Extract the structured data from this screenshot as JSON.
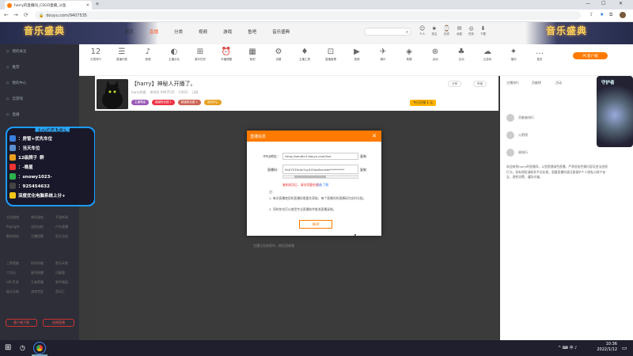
{
  "browser": {
    "tab_title": "harry的直播间_CSGO直播_斗鱼",
    "new_tab": "+",
    "url": "douyu.com/9407535",
    "win_min": "—",
    "win_max": "☐",
    "win_close": "✕",
    "nav_back": "←",
    "nav_fwd": "→",
    "nav_reload": "⟳",
    "lock": "🔒"
  },
  "site": {
    "logo_left": "音乐盛典",
    "logo_right": "音乐盛典",
    "nav": [
      "首页",
      "直播",
      "分类",
      "视频",
      "游戏",
      "鱼吧",
      "音乐盛典"
    ],
    "nav_active": 1,
    "header_icons": [
      {
        "icon": "☺",
        "label": "个人"
      },
      {
        "icon": "★",
        "label": "关注"
      },
      {
        "icon": "⌚",
        "label": "历史"
      },
      {
        "icon": "✉",
        "label": "消息"
      },
      {
        "icon": "◎",
        "label": "任务"
      },
      {
        "icon": "⬇",
        "label": "下载"
      }
    ]
  },
  "sidebar": {
    "items": [
      "我的关注",
      "推荐",
      "我的中心",
      "云游戏",
      "直播"
    ],
    "small_rows": [
      [
        "主机游戏",
        "单机游戏",
        "手游休闲"
      ],
      [
        "Popright",
        "全民自拍",
        "户外直播"
      ],
      [
        "数码科技",
        "主播招募",
        "官方活动"
      ]
    ],
    "small_rows2": [
      [
        "三家智能",
        "科学技能",
        "鱼乐天地"
      ],
      [
        "二次元",
        "星秀直播",
        "正能量"
      ],
      [
        "LOL手游",
        "王者荣耀",
        "和平精英"
      ],
      [
        "娱乐天地",
        "游戏专区",
        "音乐汇"
      ]
    ],
    "btn_left": "客户端下载",
    "btn_right": "创建直播"
  },
  "fan_panel": {
    "title": "喜欢的点点关注哦",
    "lines": [
      {
        "text": "：房管+优先车位",
        "color": "#3b7ddd"
      },
      {
        "text": "：当天车位",
        "color": "#5b8fd0"
      },
      {
        "text": "12级牌子",
        "color": "#e8a020"
      },
      {
        "text": "：-晚星",
        "color": "#e33"
      },
      {
        "text": "：snowy1023-",
        "color": "#2bb24c"
      },
      {
        "text": "：925454632",
        "color": "#444"
      },
      {
        "text": "深度优化电脑系统上分+",
        "color": "#f5c518"
      }
    ],
    "group_suffix": "群"
  },
  "icon_bar": {
    "items": [
      {
        "icon": "12",
        "label": "分类排行"
      },
      {
        "icon": "☰",
        "label": "直播列表"
      },
      {
        "icon": "♪",
        "label": "音频"
      },
      {
        "icon": "◐",
        "label": "主播论坛"
      },
      {
        "icon": "⊞",
        "label": "娱乐任务"
      },
      {
        "icon": "⏰",
        "label": "开播提醒"
      },
      {
        "icon": "▦",
        "label": "鱼吧"
      },
      {
        "icon": "⚙",
        "label": "设置"
      },
      {
        "icon": "♦",
        "label": "主播工具"
      },
      {
        "icon": "⊡",
        "label": "直播管理"
      },
      {
        "icon": "▶",
        "label": "视频"
      },
      {
        "icon": "✈",
        "label": "娱乐"
      },
      {
        "icon": "◈",
        "label": "竞猜"
      },
      {
        "icon": "⊕",
        "label": "活动"
      },
      {
        "icon": "♣",
        "label": "互动"
      },
      {
        "icon": "☁",
        "label": "云游戏"
      },
      {
        "icon": "✦",
        "label": "福利"
      },
      {
        "icon": "…",
        "label": "更多"
      }
    ],
    "pc_button": "PC客户端"
  },
  "room": {
    "title": "【harry】神秘人开播了。",
    "meta": [
      "harry的直",
      "房间号 9407535",
      "CSGO",
      "订阅"
    ],
    "tags": [
      {
        "label": "主播等级",
        "color": "#9b59b6"
      },
      {
        "label": "超级粉丝团 1",
        "color": "#e34"
      },
      {
        "label": "超级粉丝团 1",
        "color": "#c65"
      },
      {
        "label": "活动中心",
        "color": "#e8a020"
      }
    ],
    "rank": "今日可领 1 元",
    "actions": [
      "分享",
      "举报"
    ]
  },
  "video": {
    "hint": "主播正在休息中，稍后回来哦"
  },
  "right_panel": {
    "tabs": [
      "主播排行",
      "贡献榜",
      "活动"
    ],
    "rows": [
      "贡献者排行",
      "火箭榜",
      "周排行"
    ],
    "deco_title": "守护者",
    "text": "欢迎来到harry的直播间，斗鱼提倡绿色直播，严禁低俗色情内容及违法违规行为。如有侵权请联系平台处理，观看直播时请注意保护个人隐私与财产安全，理性消费，谨防诈骗。"
  },
  "modal": {
    "title": "直播信息",
    "close_x": "✕",
    "rtmp_label": "rtmp地址：",
    "rtmp_value": "rtmp://sendtc3.douyu.com/live",
    "key_label": "直播码：",
    "key_value": "9407535rAs7oy30?wsSecrete**********",
    "copy": "复制",
    "warn": "复制成功后，请勿泄露给他人",
    "warn_link": "点击了解",
    "note_title": "注：",
    "notes": [
      "1. 每次直播使用的直播码需要先获取，每个直播间的直播码为实时分配，",
      "2. 同时你也可以使用专业直播软件推流直播录制。"
    ],
    "close_button": "关闭"
  },
  "taskbar": {
    "start": "⊞",
    "time": "10:36",
    "date": "2022/1/12",
    "tray": "^ ⌨ 中 ♪"
  }
}
